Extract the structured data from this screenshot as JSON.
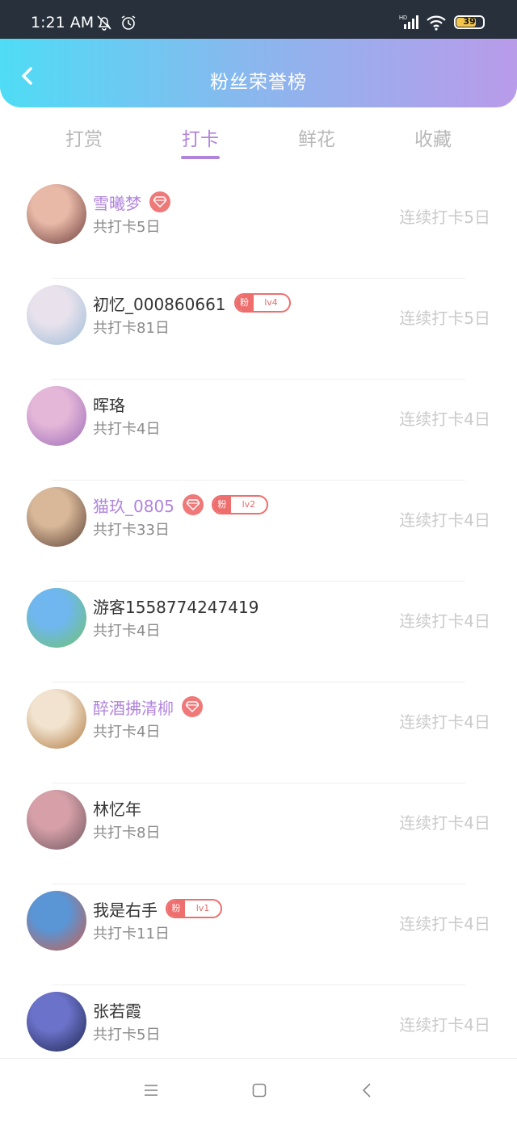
{
  "status": {
    "time": "1:21 AM",
    "battery": "39"
  },
  "header": {
    "title": "粉丝荣誉榜"
  },
  "tabs": [
    {
      "label": "打赏",
      "active": false
    },
    {
      "label": "打卡",
      "active": true
    },
    {
      "label": "鲜花",
      "active": false
    },
    {
      "label": "收藏",
      "active": false
    }
  ],
  "colors": {
    "accent": "#b184dc",
    "badge": "#ee6e6e",
    "header_start": "#4fdcf5",
    "header_end": "#b99bea"
  },
  "rows": [
    {
      "name": "雪曦梦",
      "vip": true,
      "diamond": true,
      "fan_label": "",
      "fan_level": "",
      "count": "共打卡5日",
      "streak": "连续打卡5日"
    },
    {
      "name": "初忆_000860661",
      "vip": false,
      "diamond": false,
      "fan_label": "粉",
      "fan_level": "lv4",
      "count": "共打卡81日",
      "streak": "连续打卡5日"
    },
    {
      "name": "晖珞",
      "vip": false,
      "diamond": false,
      "fan_label": "",
      "fan_level": "",
      "count": "共打卡4日",
      "streak": "连续打卡4日"
    },
    {
      "name": "猫玖_0805",
      "vip": true,
      "diamond": true,
      "fan_label": "粉",
      "fan_level": "lv2",
      "count": "共打卡33日",
      "streak": "连续打卡4日"
    },
    {
      "name": "游客1558774247419",
      "vip": false,
      "diamond": false,
      "fan_label": "",
      "fan_level": "",
      "count": "共打卡4日",
      "streak": "连续打卡4日"
    },
    {
      "name": "醉酒拂清柳",
      "vip": true,
      "diamond": true,
      "fan_label": "",
      "fan_level": "",
      "count": "共打卡4日",
      "streak": "连续打卡4日"
    },
    {
      "name": "林忆年",
      "vip": false,
      "diamond": false,
      "fan_label": "",
      "fan_level": "",
      "count": "共打卡8日",
      "streak": "连续打卡4日"
    },
    {
      "name": "我是右手",
      "vip": false,
      "diamond": false,
      "fan_label": "粉",
      "fan_level": "lv1",
      "count": "共打卡11日",
      "streak": "连续打卡4日"
    },
    {
      "name": "张若霞",
      "vip": false,
      "diamond": false,
      "fan_label": "",
      "fan_level": "",
      "count": "共打卡5日",
      "streak": "连续打卡4日"
    }
  ]
}
